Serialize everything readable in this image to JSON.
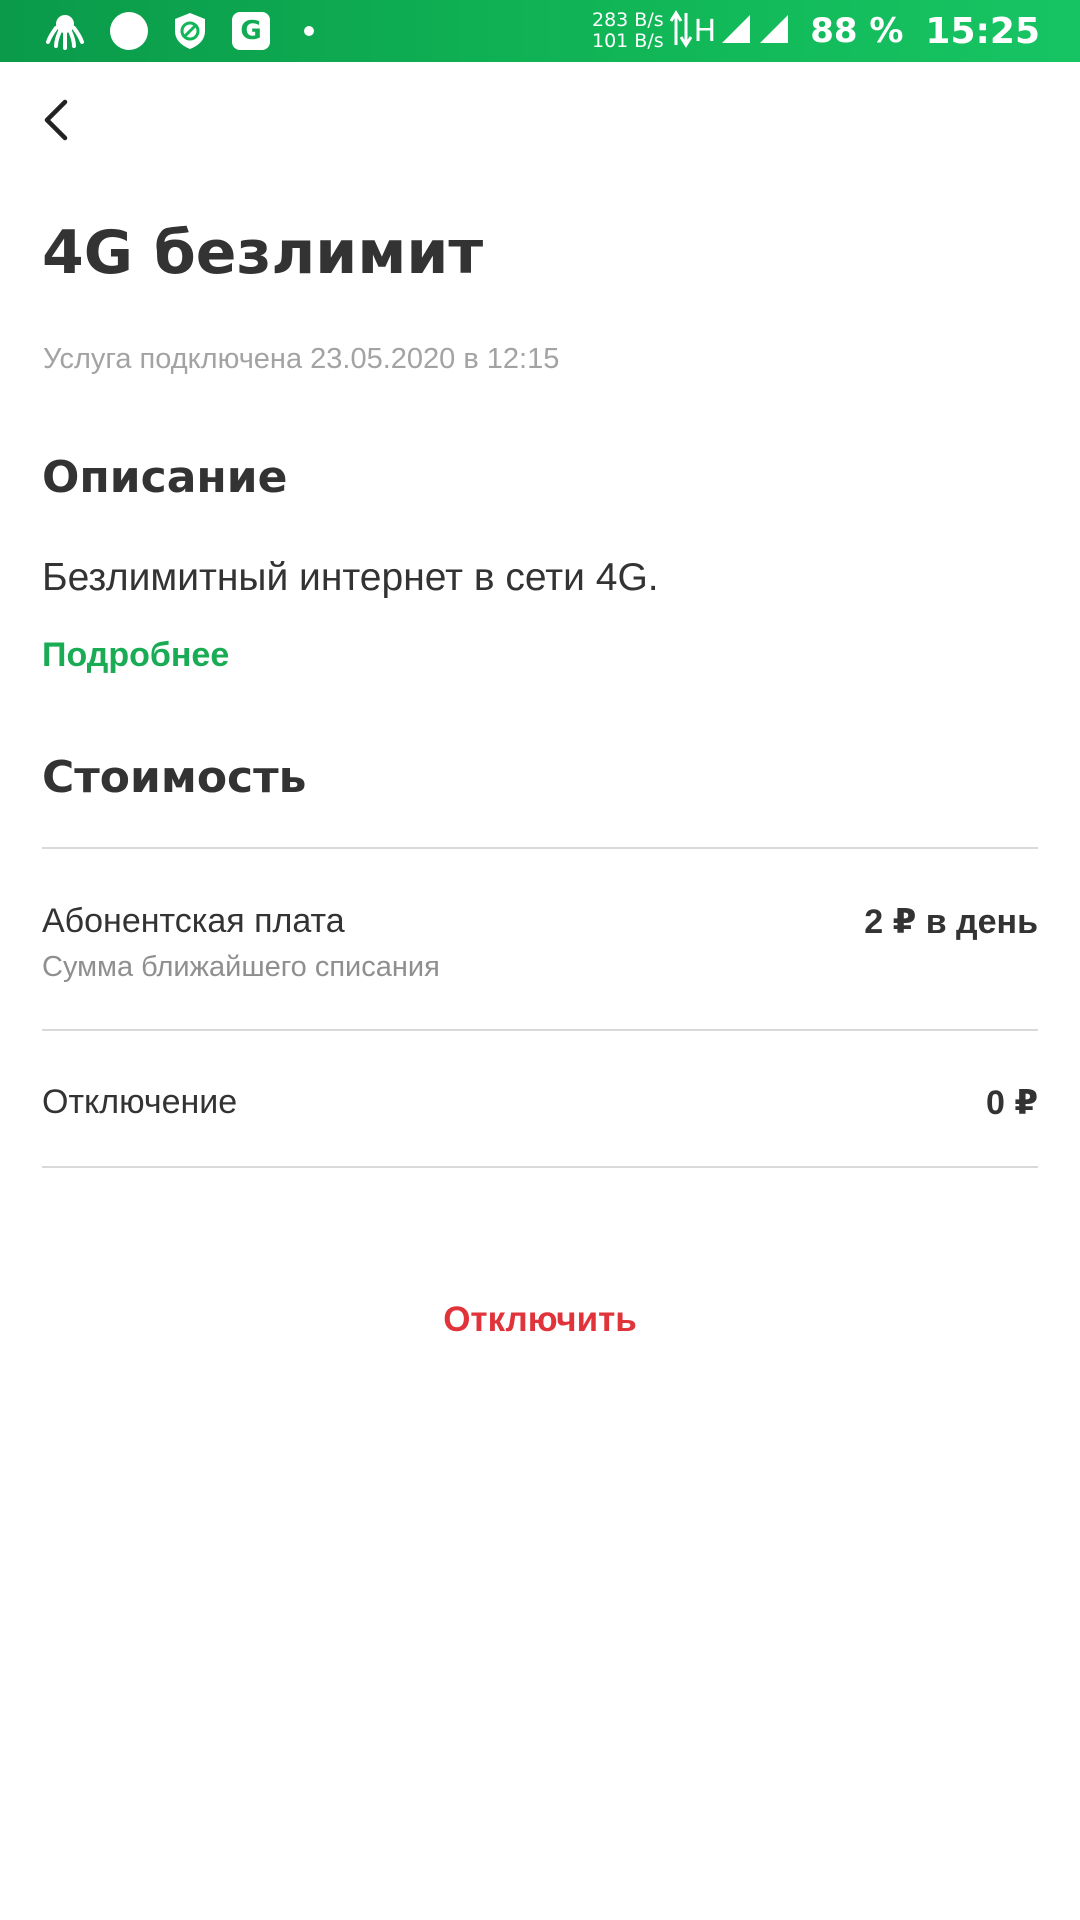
{
  "status_bar": {
    "speed_up": "283 B/s",
    "speed_down": "101 B/s",
    "network_type": "H",
    "battery": "88 %",
    "time": "15:25",
    "g_badge": "G",
    "icons": [
      "octopus-icon",
      "circle-icon",
      "shield-icon",
      "g-app-icon",
      "dot-icon",
      "data-arrows-icon",
      "signal-icon",
      "signal-icon"
    ]
  },
  "header": {
    "back_icon": "chevron-left-icon"
  },
  "service": {
    "title": "4G безлимит",
    "connected_info": "Услуга подключена 23.05.2020 в 12:15"
  },
  "description": {
    "heading": "Описание",
    "text": "Безлимитный интернет в сети 4G.",
    "more_link": "Подробнее"
  },
  "cost": {
    "heading": "Стоимость",
    "rows": [
      {
        "label": "Абонентская плата",
        "sublabel": "Сумма ближайшего списания",
        "value": "2 ₽ в день"
      },
      {
        "label": "Отключение",
        "value": "0 ₽"
      }
    ]
  },
  "actions": {
    "disconnect_label": "Отключить"
  },
  "colors": {
    "accent_green": "#1aac55",
    "status_bar_green": "#11b757",
    "danger_red": "#e0333a",
    "text_primary": "#333333",
    "text_secondary": "#a3a3a3",
    "divider": "#d9d9d9"
  }
}
